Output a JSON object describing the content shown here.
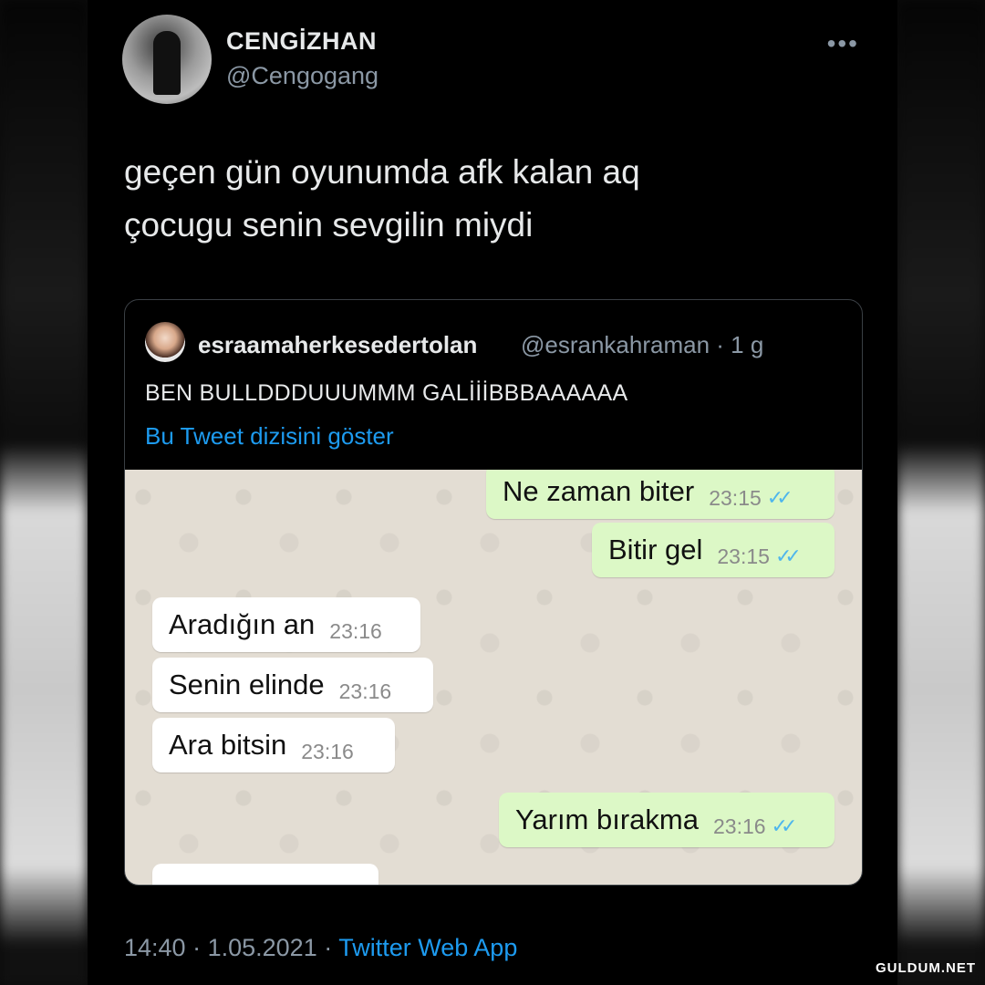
{
  "tweet": {
    "display_name": "CENGİZHAN",
    "handle": "@Cengogang",
    "more_icon": "more-horizontal-icon",
    "text_line1": "geçen gün oyunumda afk kalan aq",
    "text_line2": "çocugu senin sevgilin miydi"
  },
  "quote": {
    "name": "esraamaherkesedertolan",
    "handle": "@esrankahraman · 1 g",
    "text": "BEN BULLDDDUUUMMM GALİİİBBBAAAAAA",
    "thread_link": "Bu Tweet dizisini göster"
  },
  "chat": {
    "messages": [
      {
        "dir": "out",
        "text": "Ne zaman biter",
        "time": "23:15",
        "ticks": "✓✓"
      },
      {
        "dir": "out",
        "text": "Bitir gel",
        "time": "23:15",
        "ticks": "✓✓"
      },
      {
        "dir": "in",
        "text": "Aradığın an",
        "time": "23:16"
      },
      {
        "dir": "in",
        "text": "Senin elinde",
        "time": "23:16"
      },
      {
        "dir": "in",
        "text": "Ara bitsin",
        "time": "23:16"
      },
      {
        "dir": "out",
        "text": "Yarım bırakma",
        "time": "23:16",
        "ticks": "✓✓"
      }
    ],
    "colors": {
      "outgoing": "#dcf8c6",
      "incoming": "#ffffff",
      "ticks": "#4fb6ec"
    }
  },
  "footer": {
    "time": "14:40",
    "date": "1.05.2021",
    "source": "Twitter Web App"
  },
  "watermark": "GULDUM.NET"
}
